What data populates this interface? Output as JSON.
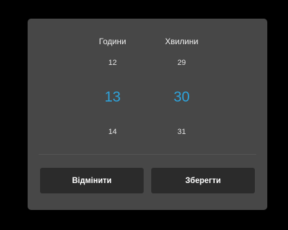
{
  "picker": {
    "hours": {
      "header": "Години",
      "prev": "12",
      "current": "13",
      "next": "14"
    },
    "minutes": {
      "header": "Хвилини",
      "prev": "29",
      "current": "30",
      "next": "31"
    }
  },
  "actions": {
    "cancel_label": "Відмінити",
    "save_label": "Зберегти"
  },
  "colors": {
    "accent": "#2ea3db",
    "dialog_bg": "#474747",
    "button_bg": "#2b2b2b",
    "backdrop": "#000000"
  }
}
